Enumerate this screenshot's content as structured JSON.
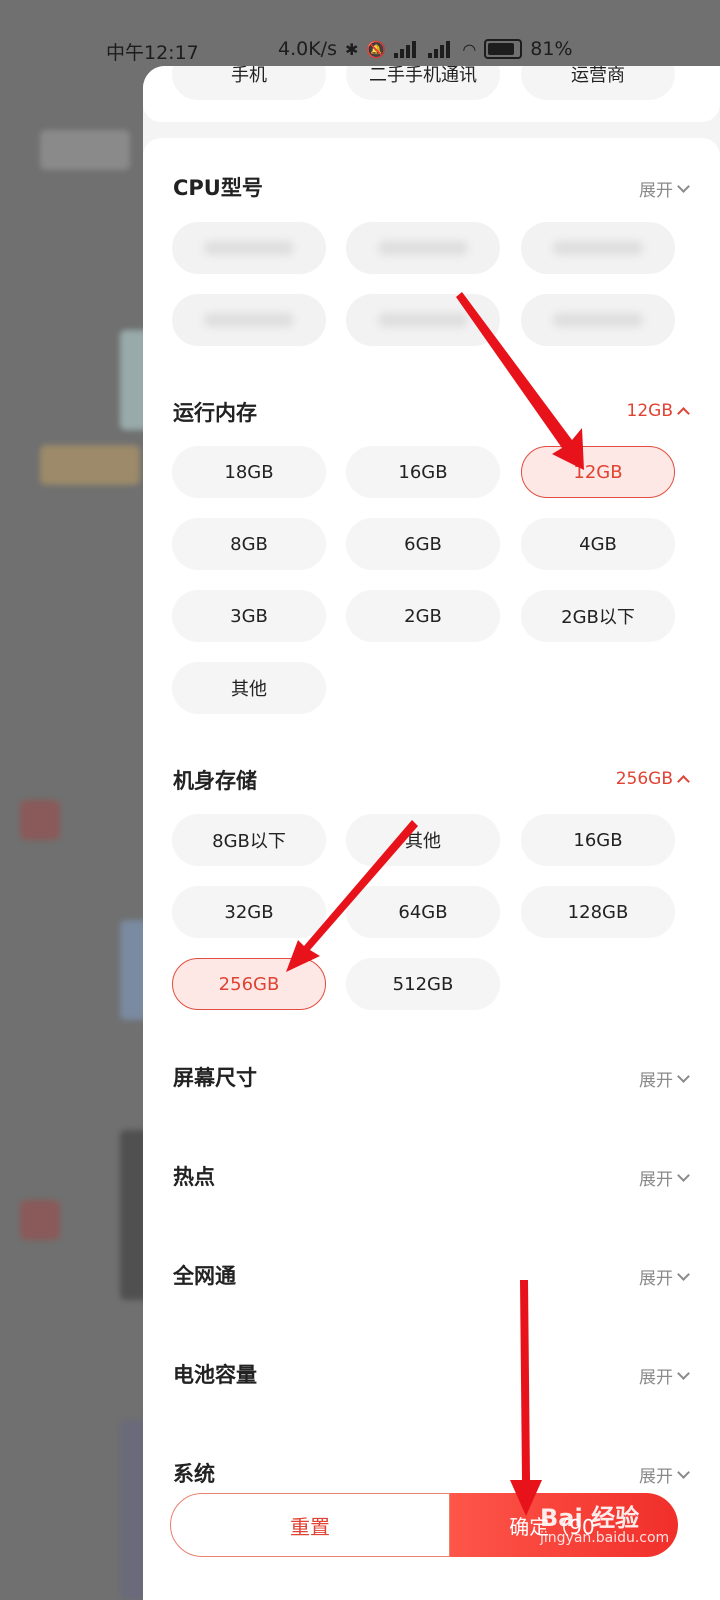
{
  "status_bar": {
    "time": "中午12:17",
    "speed": "4.0K/s",
    "battery": "81%"
  },
  "top_chips": [
    "手机",
    "二手手机通讯",
    "运营商"
  ],
  "cpu": {
    "title": "CPU型号",
    "action": "展开"
  },
  "ram": {
    "title": "运行内存",
    "selected_value": "12GB",
    "options": [
      "18GB",
      "16GB",
      "12GB",
      "8GB",
      "6GB",
      "4GB",
      "3GB",
      "2GB",
      "2GB以下",
      "其他"
    ]
  },
  "storage": {
    "title": "机身存储",
    "selected_value": "256GB",
    "options": [
      "8GB以下",
      "其他",
      "16GB",
      "32GB",
      "64GB",
      "128GB",
      "256GB",
      "512GB"
    ]
  },
  "collapsed_sections": [
    {
      "title": "屏幕尺寸",
      "action": "展开"
    },
    {
      "title": "热点",
      "action": "展开"
    },
    {
      "title": "全网通",
      "action": "展开"
    },
    {
      "title": "电池容量",
      "action": "展开"
    },
    {
      "title": "系统",
      "action": "展开"
    }
  ],
  "buttons": {
    "reset": "重置",
    "confirm": "确定（90"
  },
  "watermark": {
    "brand": "Bai 经验",
    "url": "jingyan.baidu.com"
  },
  "colors": {
    "accent": "#e04333",
    "selected_bg": "#fde8e6",
    "chip_bg": "#f5f5f5"
  }
}
